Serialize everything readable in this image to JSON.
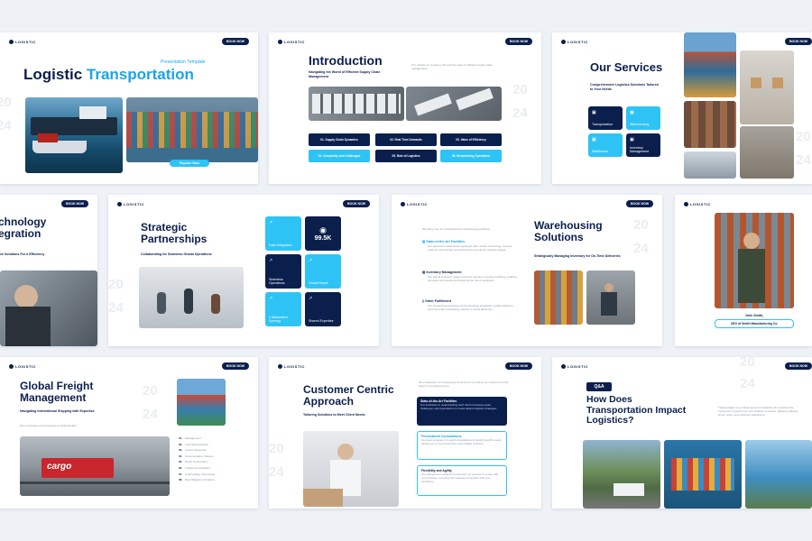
{
  "common": {
    "logo": "LOGISTIC",
    "book_now": "BOOK NOW",
    "year_top": "20",
    "year_bottom": "24"
  },
  "s1": {
    "subtitle": "Presentation Template",
    "title_a": "Logistic ",
    "title_b": "Transportation",
    "cta": "Explore Now"
  },
  "s2": {
    "title": "Introduction",
    "subtitle": "Navigating the World of Efficient Supply Chain Management",
    "body": "Our mission on a journey through the realm of efficient supply chain management.",
    "pills": [
      "01. Supply Chain Dynamics",
      "02. Real Time Demands",
      "03. Value of Efficiency",
      "04. Complexity and Challenges",
      "05. Role of Logistics",
      "06. Streamlining Operations"
    ]
  },
  "s3": {
    "title": "Our Services",
    "subtitle": "Comprehensive Logistics Solutions Tailored to Your Needs",
    "tiles": [
      "Transportation",
      "Warehousing",
      "Distribution",
      "Inventory Management"
    ]
  },
  "s4": {
    "title_a": "chnology",
    "title_b": "egration",
    "subtitle": "ve Solutions For d Efficiency"
  },
  "s5": {
    "title": "Strategic Partnerships",
    "subtitle": "Collaborating for Seamless Global Operations",
    "stat": "99.5K",
    "tiles": [
      "Data Integration",
      "Seamless Operations",
      "Global Reach",
      "Collaborative Synergy",
      "Shared Expertise"
    ]
  },
  "s6": {
    "title": "Warehousing Solutions",
    "subtitle": "Strategically Managing Inventory for On-Time Deliveries",
    "intro": "We delve into our comprehensive warehousing solutions.",
    "items": [
      {
        "title": "State-of-the-Art Facilities",
        "text": "Our advanced warehouses equipped with modern technology, security systems, and climate-controlled environments for optimal storage."
      },
      {
        "title": "Inventory Management",
        "text": "Our robust inventory system ensures real-time inventory tracking, enabling accurate stock levels and reducing the risk of stockouts."
      },
      {
        "title": "Order Fulfillment",
        "text": "Our streamlined processes and technology integration enable swift and accurate order processing, leading to timely deliveries."
      }
    ]
  },
  "s7": {
    "name": "John Smith,",
    "role": "CEO of Smith Manufacturing Co."
  },
  "s8": {
    "title": "Global Freight Management",
    "subtitle": "Navigating International Shipping with Expertise",
    "body": "We encourage our businesses on global freight.",
    "photo_text": "cargo",
    "list": [
      {
        "n": "01.",
        "t": "Management"
      },
      {
        "n": "02.",
        "t": "International Reach"
      },
      {
        "n": "03.",
        "t": "Custom Expertise"
      },
      {
        "n": "04.",
        "t": "Documentation Mastery"
      },
      {
        "n": "05.",
        "t": "Route Optimization"
      },
      {
        "n": "06.",
        "t": "Freight Consolidation"
      },
      {
        "n": "07.",
        "t": "Cutting-Edge Technology"
      },
      {
        "n": "08.",
        "t": "Risk Mitigation Solutions"
      }
    ]
  },
  "s9": {
    "title": "Customer Centric Approach",
    "subtitle": "Tailoring Solutions to Meet Client Needs",
    "intro": "We emphasize our unwavering commitment to putting our customers at the heart of everything we do.",
    "cards": [
      {
        "title": "State-of-the-Art Facilities",
        "text": "Our dedication to understanding each client's business goals, challenges, and expectations to create tailored logistics strategies."
      },
      {
        "title": "Personalized Consultations",
        "text": "Our team engages in in-depth consultations to identify specific needs, allowing us to recommend the most suitable solutions."
      },
      {
        "title": "Flexibility and Agility",
        "text": "Our willingness to adapt and customize our services to evolve with your business, ensuring your seamless integration with your operations."
      }
    ]
  },
  "s10": {
    "qa": "Q&A",
    "title": "How Does Transportation Impact Logistics?",
    "body": "Transportation is a critical element of logistics as it involves the movement of goods from one location to another, affecting delivery times, costs, and customer satisfaction."
  }
}
